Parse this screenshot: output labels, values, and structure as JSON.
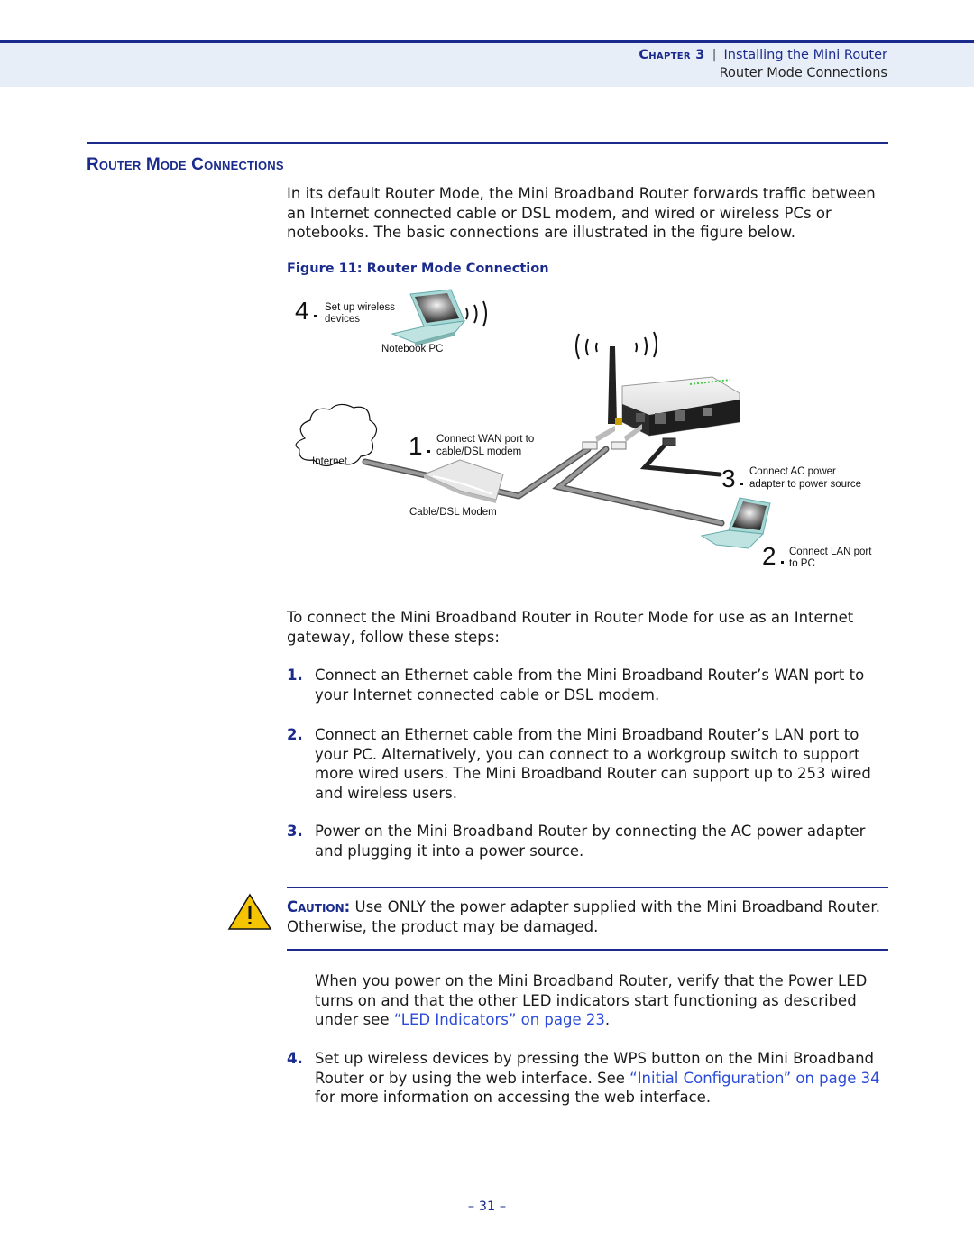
{
  "header": {
    "chapter_label": "Chapter 3",
    "separator": "|",
    "chapter_title": "Installing the Mini Router",
    "section_title": "Router Mode Connections"
  },
  "section": {
    "title": "Router Mode Connections",
    "intro": "In its default Router Mode, the Mini Broadband Router forwards traffic between an Internet connected cable or DSL modem, and wired or wireless PCs or notebooks. The basic connections are illustrated in the figure below."
  },
  "figure": {
    "caption": "Figure 11:  Router Mode Connection",
    "labels": {
      "notebook_pc": "Notebook PC",
      "internet": "Internet",
      "cable_modem": "Cable/DSL Modem"
    },
    "callouts": [
      {
        "number": "4",
        "line1": "Set up wireless",
        "line2": "devices"
      },
      {
        "number": "1",
        "line1": "Connect WAN port to",
        "line2": "cable/DSL modem"
      },
      {
        "number": "3",
        "line1": "Connect AC power",
        "line2": "adapter to power source"
      },
      {
        "number": "2",
        "line1": "Connect LAN port",
        "line2": "to PC"
      }
    ]
  },
  "steps_intro": "To connect the Mini Broadband Router in Router Mode for use as an Internet gateway, follow these steps:",
  "steps": [
    {
      "num": "1.",
      "text": "Connect an Ethernet cable from the Mini Broadband Router’s WAN port to your Internet connected cable or DSL modem."
    },
    {
      "num": "2.",
      "text": "Connect an Ethernet cable from the Mini Broadband Router’s LAN port to your PC. Alternatively, you can connect to a workgroup switch to support more wired users. The Mini Broadband Router can support up to 253 wired and wireless users."
    },
    {
      "num": "3.",
      "text": "Power on the Mini Broadband Router by connecting the AC power adapter and plugging it into a power source."
    }
  ],
  "caution": {
    "label": "Caution:",
    "text": " Use ONLY the power adapter supplied with the Mini Broadband Router. Otherwise, the product may be damaged."
  },
  "power_note": {
    "before": "When you power on the Mini Broadband Router, verify that the Power LED turns on and that the other LED indicators start functioning as described under see ",
    "link": "“LED Indicators” on page 23",
    "after": "."
  },
  "step4": {
    "num": "4.",
    "before": "Set up wireless devices by pressing the WPS button on the Mini Broadband Router or by using the web interface. See ",
    "link": "“Initial Configuration” on page 34",
    "after": " for more information on accessing the web interface."
  },
  "page_number": "–  31  –"
}
